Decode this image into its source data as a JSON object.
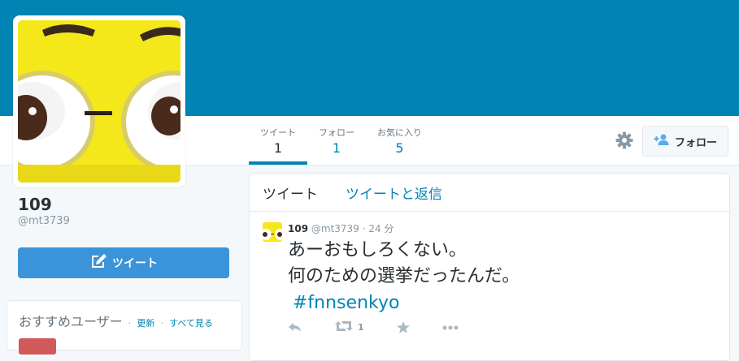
{
  "colors": {
    "header": "#0084b4",
    "link": "#0084b4",
    "tweet_button": "#3b94d9"
  },
  "profile": {
    "name": "109",
    "handle": "@mt3739"
  },
  "nav": {
    "stats": [
      {
        "label": "ツイート",
        "value": "1",
        "active": true
      },
      {
        "label": "フォロー",
        "value": "1"
      },
      {
        "label": "お気に入り",
        "value": "5"
      }
    ],
    "settings_icon": "gear-icon",
    "follow_label": "フォロー",
    "follow_icon": "add-user-icon"
  },
  "sidebar": {
    "tweet_button_label": "ツイート",
    "tweet_button_icon": "compose-icon",
    "who_to_follow": {
      "title": "おすすめユーザー",
      "refresh": "更新",
      "view_all": "すべて見る",
      "separator": "·"
    }
  },
  "timeline": {
    "tabs": [
      "ツイート",
      "ツイートと返信"
    ],
    "tweet": {
      "name": "109",
      "handle": "@mt3739",
      "separator": "·",
      "time": "24 分",
      "lines": [
        "あーおもしろくない。",
        "何のための選挙だったんだ。"
      ],
      "hashtag": "#fnnsenkyo",
      "retweet_count": "1"
    }
  }
}
